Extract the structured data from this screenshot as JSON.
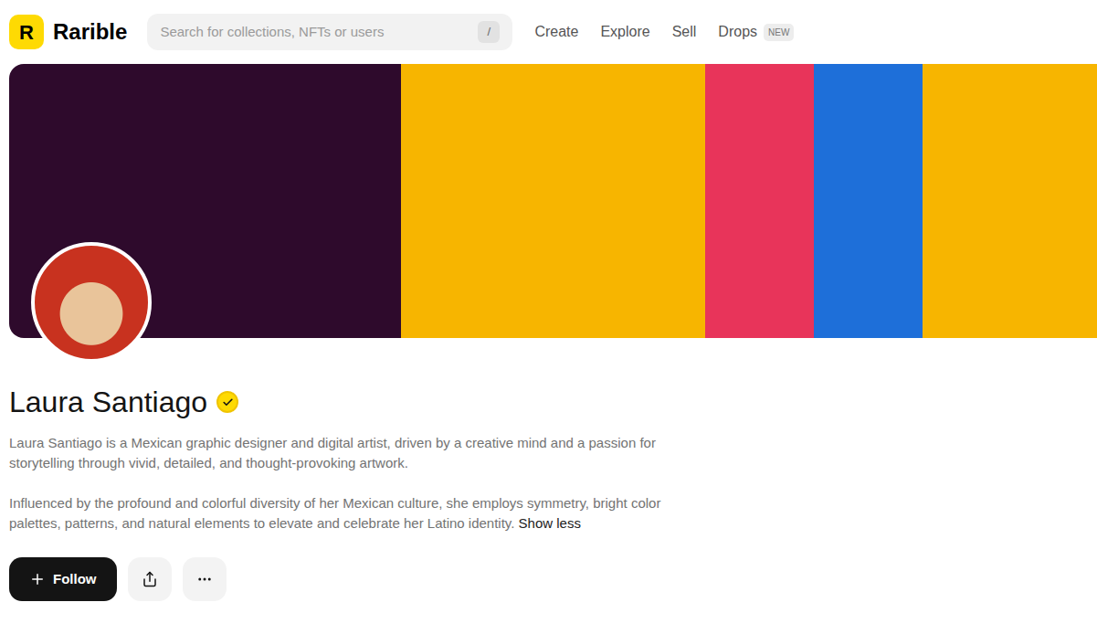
{
  "header": {
    "logo_mark": "R",
    "brand": "Rarible",
    "search": {
      "placeholder": "Search for collections, NFTs or users",
      "shortcut": "/"
    },
    "nav": [
      {
        "label": "Create",
        "badge": ""
      },
      {
        "label": "Explore",
        "badge": ""
      },
      {
        "label": "Sell",
        "badge": ""
      },
      {
        "label": "Drops",
        "badge": "NEW"
      }
    ]
  },
  "profile": {
    "name": "Laura Santiago",
    "verified": true,
    "bio": [
      "Laura Santiago is a Mexican graphic designer and digital artist, driven by a creative mind and a passion for storytelling through vivid, detailed, and thought-provoking artwork.",
      "Influenced by the profound and colorful diversity of her Mexican culture, she employs symmetry, bright color palettes, patterns, and natural elements to elevate and celebrate her Latino identity."
    ],
    "toggle": "Show less",
    "actions": {
      "follow": "Follow"
    }
  }
}
